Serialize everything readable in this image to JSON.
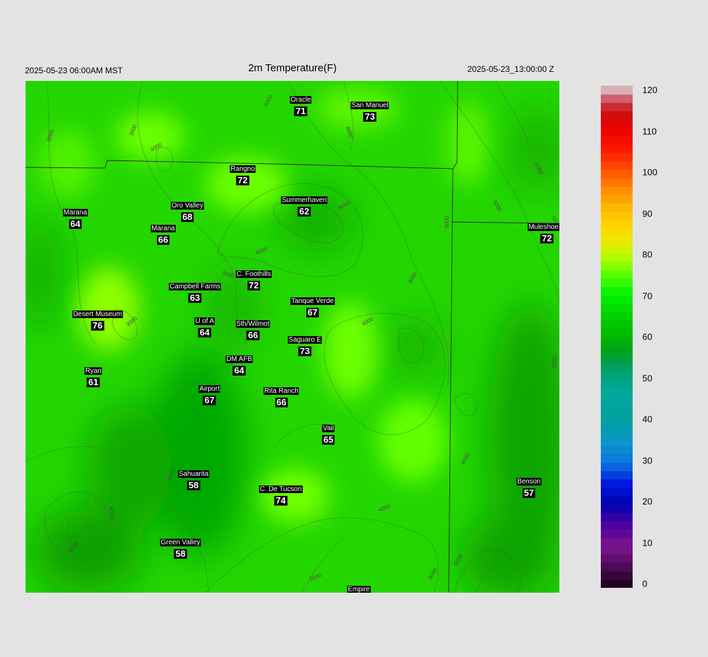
{
  "header": {
    "valid_time_local": "2025-05-23 06:00AM MST",
    "title": "2m Temperature(F)",
    "valid_time_utc": "2025-05-23_13:00:00 Z"
  },
  "stations": [
    {
      "id": "oracle",
      "name": "Oracle",
      "value": "71"
    },
    {
      "id": "san-manuel",
      "name": "San Manuel",
      "value": "73"
    },
    {
      "id": "rangno",
      "name": "Rangno",
      "value": "72"
    },
    {
      "id": "summerhaven",
      "name": "Summerhaven",
      "value": "62"
    },
    {
      "id": "marana-west",
      "name": "Marana",
      "value": "64"
    },
    {
      "id": "oro-valley",
      "name": "Oro Valley",
      "value": "68"
    },
    {
      "id": "marana",
      "name": "Marana",
      "value": "66"
    },
    {
      "id": "muleshoe-r",
      "name": "Muleshoe R",
      "value": "72"
    },
    {
      "id": "c-foothills",
      "name": "C. Foothills",
      "value": "72"
    },
    {
      "id": "campbell-farms",
      "name": "Campbell Farms",
      "value": "63"
    },
    {
      "id": "tanque-verde",
      "name": "Tanque Verde",
      "value": "67"
    },
    {
      "id": "desert-museum",
      "name": "Desert Museum",
      "value": "76"
    },
    {
      "id": "u-of-a",
      "name": "U of A",
      "value": "64"
    },
    {
      "id": "5th-wilmot",
      "name": "5th/Wilmot",
      "value": "66"
    },
    {
      "id": "saguaro-e",
      "name": "Saguaro E",
      "value": "73"
    },
    {
      "id": "dm-afb",
      "name": "DM AFB",
      "value": "64"
    },
    {
      "id": "ryan",
      "name": "Ryan",
      "value": "61"
    },
    {
      "id": "airport",
      "name": "Airport",
      "value": "67"
    },
    {
      "id": "rita-ranch",
      "name": "Rita Ranch",
      "value": "66"
    },
    {
      "id": "vail",
      "name": "Vail",
      "value": "65"
    },
    {
      "id": "sahuarita",
      "name": "Sahuarita",
      "value": "58"
    },
    {
      "id": "c-de-tucson",
      "name": "C. De Tucson",
      "value": "74"
    },
    {
      "id": "benson",
      "name": "Benson",
      "value": "57"
    },
    {
      "id": "green-valley",
      "name": "Green Valley",
      "value": "58"
    },
    {
      "id": "empire",
      "name": "Empire",
      "value": ""
    }
  ],
  "contour_labels": [
    "3000",
    "3000",
    "4000",
    "4000",
    "4000",
    "3000",
    "6000",
    "5000",
    "3000",
    "4000",
    "4000",
    "5000",
    "4000",
    "5000",
    "5000",
    "5000",
    "4000",
    "3000",
    "4000",
    "5000",
    "5000",
    "6000",
    "5000",
    "4000"
  ],
  "colorbar": {
    "ticks": [
      "120",
      "110",
      "100",
      "90",
      "80",
      "70",
      "60",
      "50",
      "40",
      "30",
      "20",
      "10",
      "0"
    ],
    "min": 0,
    "max": 120,
    "stops": [
      {
        "t": 0,
        "c": "#1a0014"
      },
      {
        "t": 5,
        "c": "#4a0a55"
      },
      {
        "t": 10,
        "c": "#7e158e"
      },
      {
        "t": 15,
        "c": "#5000a0"
      },
      {
        "t": 20,
        "c": "#0000b0"
      },
      {
        "t": 25,
        "c": "#0018e0"
      },
      {
        "t": 30,
        "c": "#0a78e0"
      },
      {
        "t": 35,
        "c": "#0a96c8"
      },
      {
        "t": 40,
        "c": "#00a0a0"
      },
      {
        "t": 47,
        "c": "#00a89a"
      },
      {
        "t": 52,
        "c": "#00a070"
      },
      {
        "t": 56,
        "c": "#00a020"
      },
      {
        "t": 60,
        "c": "#00b800"
      },
      {
        "t": 65,
        "c": "#00d000"
      },
      {
        "t": 70,
        "c": "#00f000"
      },
      {
        "t": 74,
        "c": "#40ff00"
      },
      {
        "t": 78,
        "c": "#a0ff00"
      },
      {
        "t": 82,
        "c": "#e0f000"
      },
      {
        "t": 86,
        "c": "#ffd800"
      },
      {
        "t": 90,
        "c": "#ffc000"
      },
      {
        "t": 95,
        "c": "#ff9000"
      },
      {
        "t": 100,
        "c": "#ff5000"
      },
      {
        "t": 105,
        "c": "#ff1800"
      },
      {
        "t": 110,
        "c": "#e80000"
      },
      {
        "t": 114,
        "c": "#cc1010"
      },
      {
        "t": 117,
        "c": "#d06070"
      },
      {
        "t": 120,
        "c": "#d8d8d8"
      }
    ]
  },
  "colors": {
    "background": "#e3e3e3",
    "field_base": "#22d800",
    "warm": "#7cff00",
    "cool": "#05a800"
  }
}
